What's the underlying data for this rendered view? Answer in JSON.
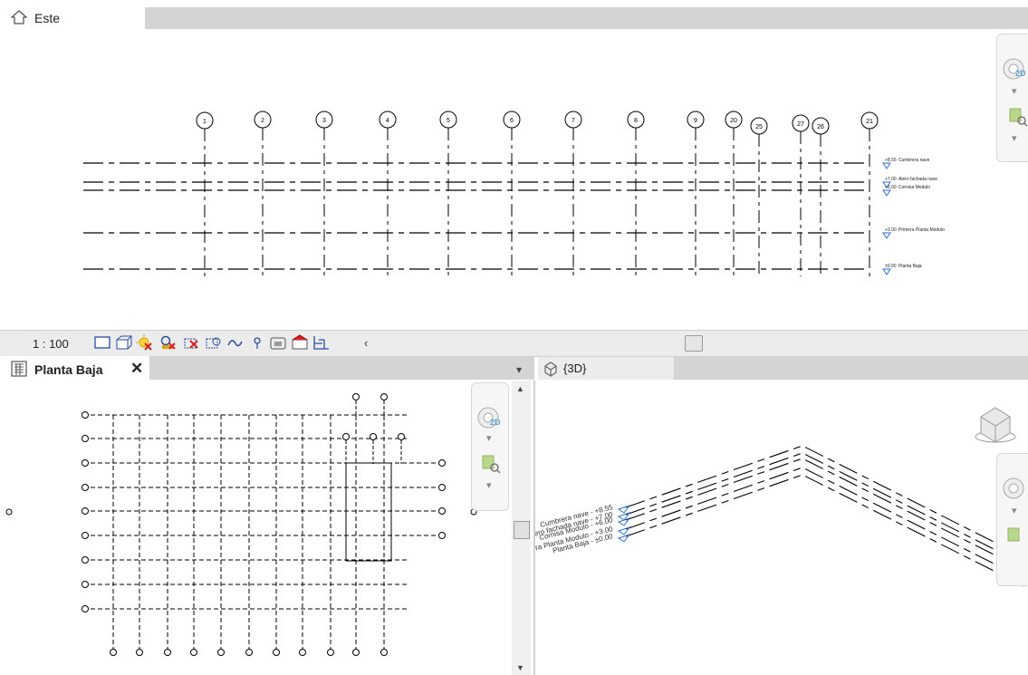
{
  "elevation_view": {
    "title": "Este",
    "grid_labels": [
      "1",
      "2",
      "3",
      "4",
      "5",
      "6",
      "7",
      "8",
      "9",
      "20",
      "25",
      "27",
      "26",
      "21"
    ],
    "level_labels": [
      {
        "elev": "+8.55",
        "name": "Cumbrera nave"
      },
      {
        "elev": "+7.00",
        "name": "Alero fachada nave"
      },
      {
        "elev": "+6.00",
        "name": "Cornisa Modulo"
      },
      {
        "elev": "+3.00",
        "name": "Primera Planta Modulo"
      },
      {
        "elev": "±0.00",
        "name": "Planta Baja"
      }
    ]
  },
  "statusbar": {
    "scale": "1 : 100",
    "tools": [
      "detail-level-icon",
      "visual-style-icon",
      "sun-path-icon",
      "shadows-icon",
      "crop-view-icon",
      "show-crop-icon",
      "unlock-3d-icon",
      "temporary-hide-icon",
      "reveal-hidden-icon",
      "worksharing-icon",
      "analytical-model-icon"
    ],
    "arrow": "‹"
  },
  "plan_view": {
    "title": "Planta Baja",
    "close": "✕",
    "menu": "▾"
  },
  "view_3d": {
    "title": "{3D}",
    "level_labels": [
      {
        "name": "Cumbrera nave",
        "elev": "+8.55"
      },
      {
        "name": "Alero fachada nave",
        "elev": "+7.00"
      },
      {
        "name": "Cornisa Modulo",
        "elev": "+6.00"
      },
      {
        "name": "Primera Planta Modulo",
        "elev": "+3.00"
      },
      {
        "name": "Planta Baja",
        "elev": "±0.00"
      }
    ]
  },
  "navbar": {
    "wheel_label": "2D",
    "dropdown": "▾"
  }
}
